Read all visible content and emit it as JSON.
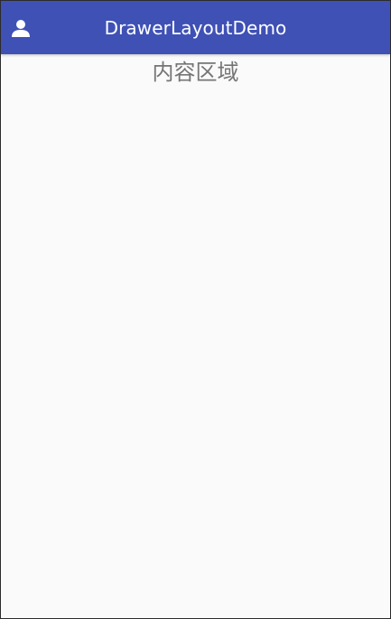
{
  "app": {
    "title": "DrawerLayoutDemo",
    "nav_icon": "person-icon"
  },
  "content": {
    "label": "内容区域"
  },
  "colors": {
    "primary": "#3f51b5",
    "background": "#fafafa",
    "content_text": "#757575",
    "title_text": "#ffffff"
  }
}
